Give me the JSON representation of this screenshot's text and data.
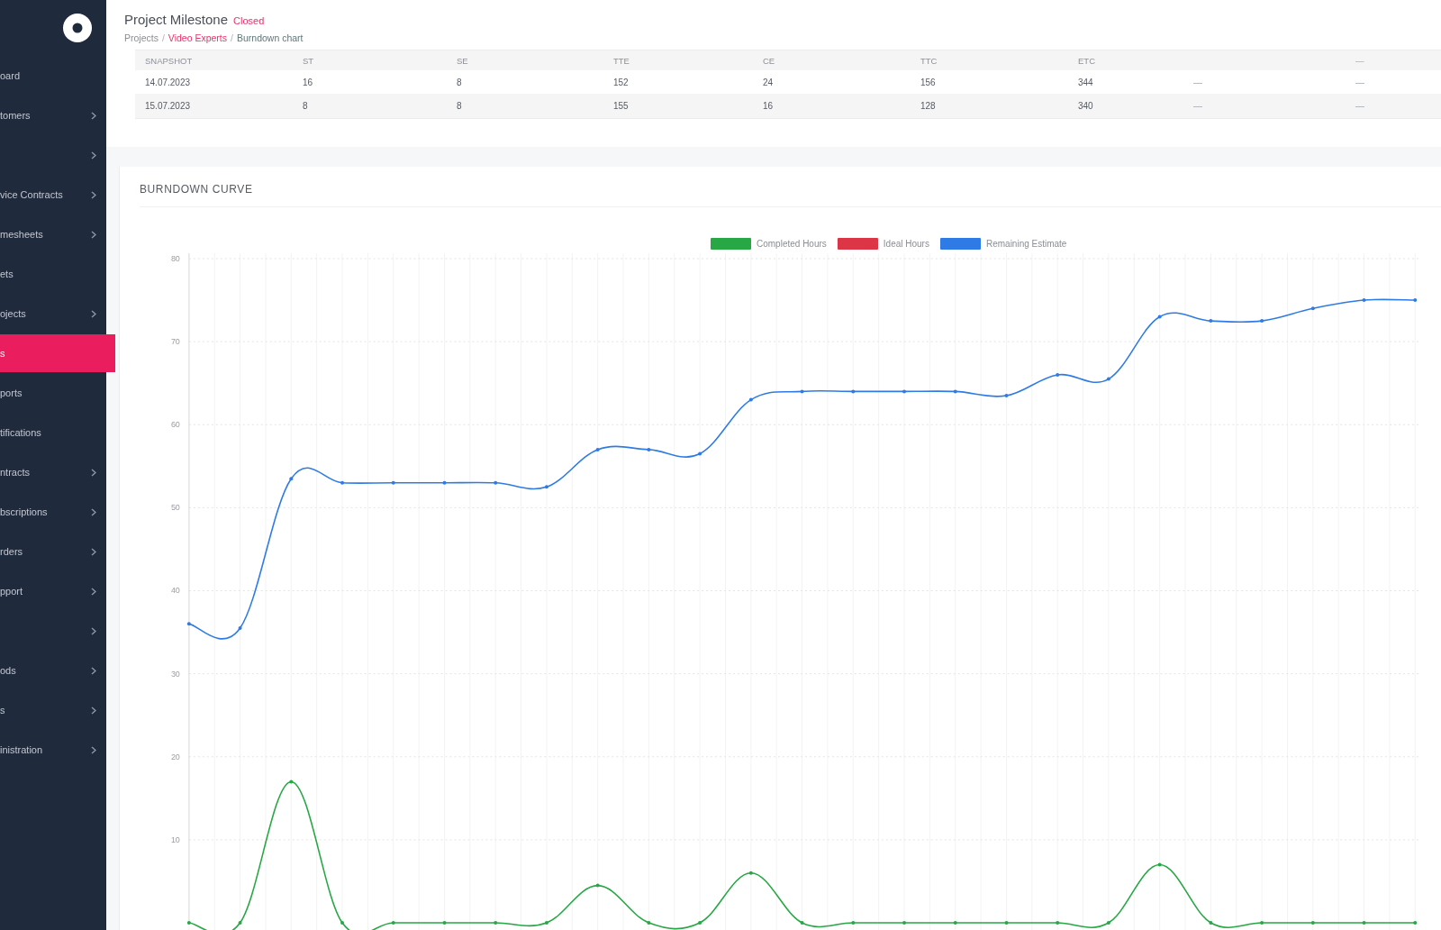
{
  "sidebar": {
    "items": [
      {
        "label": "oard",
        "expandable": false,
        "selected": false
      },
      {
        "label": "tomers",
        "expandable": true,
        "selected": false
      },
      {
        "expandable": true,
        "selected": false
      },
      {
        "label": "vice Contracts",
        "expandable": true,
        "selected": false
      },
      {
        "label": "mesheets",
        "expandable": true,
        "selected": false
      },
      {
        "label": "ets",
        "expandable": false,
        "selected": false
      },
      {
        "label": "ojects",
        "expandable": true,
        "selected": false
      },
      {
        "label": "s",
        "expandable": false,
        "selected": true
      },
      {
        "label": "ports",
        "expandable": false,
        "selected": false
      },
      {
        "label": "tifications",
        "expandable": false,
        "selected": false
      },
      {
        "label": "ntracts",
        "expandable": true,
        "selected": false
      },
      {
        "label": "bscriptions",
        "expandable": true,
        "selected": false
      },
      {
        "label": "rders",
        "expandable": true,
        "selected": false
      },
      {
        "label": "pport",
        "expandable": true,
        "selected": false
      },
      {
        "expandable": true,
        "selected": false
      },
      {
        "label": "ods",
        "expandable": true,
        "selected": false
      },
      {
        "label": "s",
        "expandable": true,
        "selected": false
      },
      {
        "label": "inistration",
        "expandable": true,
        "selected": false
      }
    ]
  },
  "header": {
    "title": "Project Milestone",
    "status": "Closed",
    "breadcrumb": {
      "separator": "/",
      "items": [
        {
          "label": "Projects",
          "kind": "label"
        },
        {
          "label": "Video Experts",
          "kind": "link"
        },
        {
          "label": "Burndown chart",
          "kind": "current"
        }
      ]
    }
  },
  "table": {
    "columns": [
      {
        "label": "SNAPSHOT"
      },
      {
        "label": "ST"
      },
      {
        "label": "SE"
      },
      {
        "label": "TTE"
      },
      {
        "label": "CE"
      },
      {
        "label": "TTC"
      },
      {
        "label": "ETC"
      },
      {},
      {
        "label": "—"
      }
    ],
    "rows": [
      [
        "14.07.2023",
        "16",
        "8",
        "152",
        "24",
        "156",
        "344",
        "—",
        "—"
      ],
      [
        "15.07.2023",
        "8",
        "8",
        "155",
        "16",
        "128",
        "340",
        "—",
        "—"
      ]
    ]
  },
  "chart": {
    "title": "BURNDOWN CURVE",
    "chart_data": {
      "type": "line",
      "ylim": [
        0,
        80
      ],
      "yticks": [
        10,
        20,
        30,
        40,
        50,
        60,
        70,
        80
      ],
      "grid": true,
      "series": [
        {
          "name": "Completed Hours",
          "color": "#28a745",
          "values": [
            0,
            0,
            17,
            0,
            0,
            0,
            0,
            0,
            4.5,
            0,
            0,
            6,
            0,
            0,
            0,
            0,
            0,
            0,
            0,
            7,
            0,
            0,
            0,
            0,
            0
          ]
        },
        {
          "name": "Ideal Hours",
          "color": "#dc3545",
          "values": [
            null,
            null,
            null,
            null,
            null,
            null,
            null,
            null,
            null,
            null,
            null,
            null,
            null,
            null,
            null,
            null,
            null,
            null,
            null,
            null,
            null,
            null,
            null,
            null,
            null
          ]
        },
        {
          "name": "Remaining Estimate",
          "color": "#2f7be5",
          "values": [
            36,
            35.5,
            53.5,
            53,
            53,
            53,
            53,
            52.5,
            57,
            57,
            56.5,
            63,
            64,
            64,
            64,
            64,
            63.5,
            66,
            65.5,
            73,
            72.5,
            72.5,
            74,
            75,
            75
          ]
        }
      ]
    }
  }
}
